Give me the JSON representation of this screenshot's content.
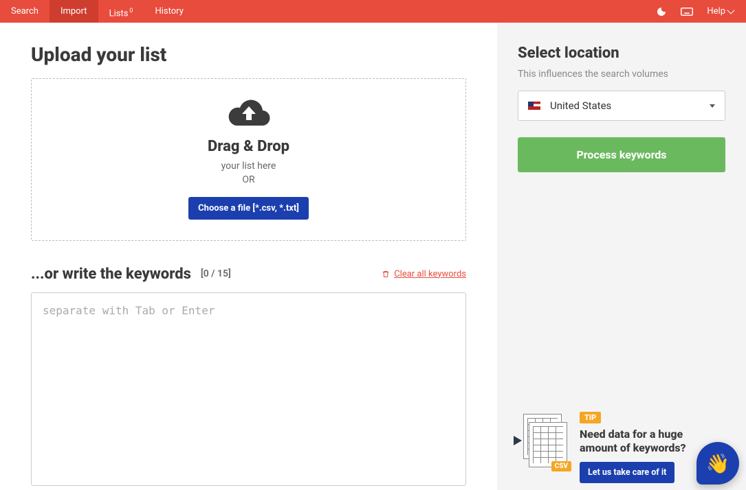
{
  "nav": {
    "items": [
      {
        "label": "Search"
      },
      {
        "label": "Import"
      },
      {
        "label": "Lists",
        "badge": "0"
      },
      {
        "label": "History"
      }
    ],
    "help_label": "Help"
  },
  "main": {
    "upload_heading": "Upload your list",
    "dropzone": {
      "title": "Drag & Drop",
      "subtitle_line1": "your list here",
      "subtitle_line2": "OR",
      "choose_button": "Choose a file [*.csv, *.txt]"
    },
    "write_heading": "...or write the keywords",
    "counter": "[0 / 15]",
    "clear_label": "Clear all keywords",
    "textarea_placeholder": "separate with Tab or Enter"
  },
  "sidebar": {
    "heading": "Select location",
    "subtext": "This influences the search volumes",
    "location_selected": "United States",
    "process_button": "Process keywords",
    "tip": {
      "badge": "TIP",
      "title": "Need data for a huge amount of keywords?",
      "button": "Let us take care of it",
      "csv_badge": "CSV"
    }
  }
}
